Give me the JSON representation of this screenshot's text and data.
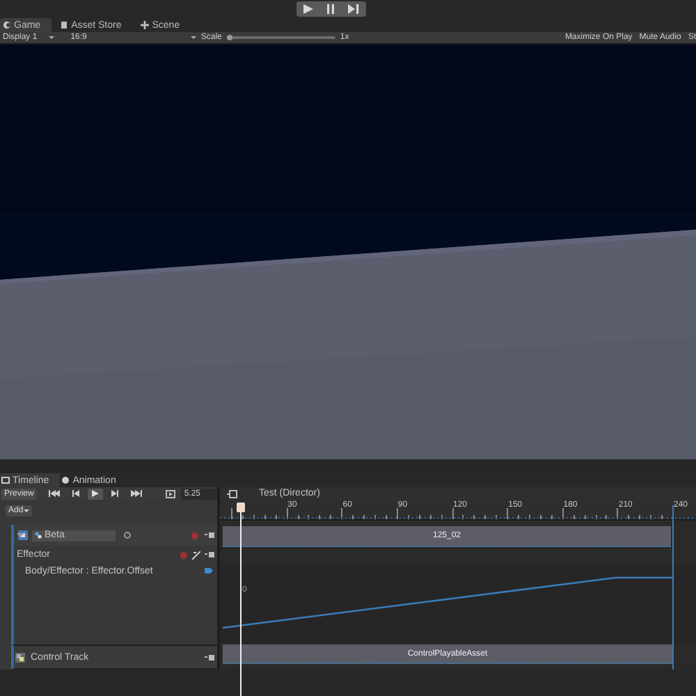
{
  "editor_tabs": [
    {
      "label": "Game",
      "selected": true
    },
    {
      "label": "Asset Store",
      "selected": false
    },
    {
      "label": "Scene",
      "selected": false
    }
  ],
  "game_toolbar": {
    "display": "Display 1",
    "aspect": "16:9",
    "scale_label": "Scale",
    "scale_slider": {
      "level": 0
    },
    "scale_value": "1x",
    "options": [
      "Maximize On Play",
      "Mute Audio",
      "St"
    ]
  },
  "timeline": {
    "tabs": [
      {
        "label": "Timeline",
        "selected": true
      },
      {
        "label": "Animation",
        "selected": false
      }
    ],
    "preview_button": "Preview",
    "frame": "5.25",
    "add_button": "Add",
    "director": "Test (Director)",
    "ruler_ticks": [
      "30",
      "60",
      "90",
      "120",
      "150",
      "180",
      "210",
      "240"
    ],
    "animation_track": {
      "name": "Beta",
      "expanded": true,
      "clip": "125_02"
    },
    "effector_group": {
      "name": "Effector"
    },
    "curve_track": {
      "property": "Body/Effector : Effector.Offset",
      "axis_label": "0"
    },
    "control_track": {
      "name": "Control Track",
      "clip": "ControlPlayableAsset"
    }
  }
}
